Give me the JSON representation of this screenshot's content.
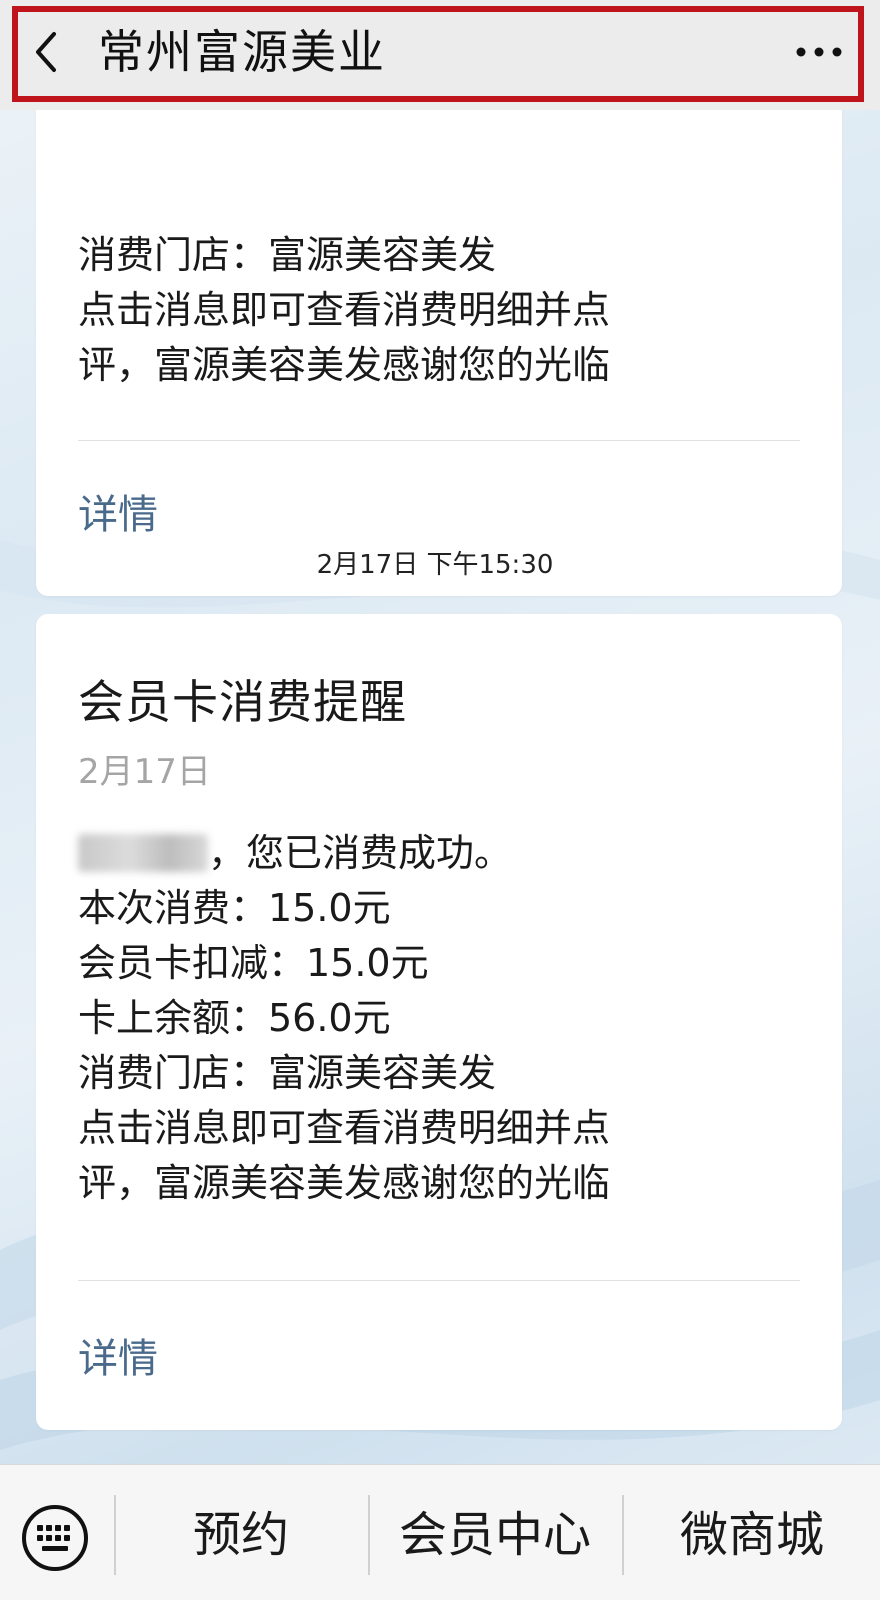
{
  "header": {
    "title": "常州富源美业",
    "back_icon": "chevron-left-icon",
    "more_icon": "more-dots-icon",
    "highlight_color": "#c0141c"
  },
  "messages": [
    {
      "lines": [
        "消费门店：富源美容美发",
        "点击消息即可查看消费明细并点",
        "评，富源美容美发感谢您的光临"
      ],
      "detail_label": "详情"
    },
    {
      "timestamp": "2月17日 下午15:30",
      "title": "会员卡消费提醒",
      "date": "2月17日",
      "greeting_suffix": "，您已消费成功。",
      "lines": [
        "本次消费：15.0元",
        "会员卡扣减：15.0元",
        "卡上余额：56.0元",
        "消费门店：富源美容美发",
        "点击消息即可查看消费明细并点",
        "评，富源美容美发感谢您的光临"
      ],
      "detail_label": "详情"
    }
  ],
  "bottom_menu": {
    "keyboard_icon": "keyboard-icon",
    "items": [
      "预约",
      "会员中心",
      "微商城"
    ]
  }
}
